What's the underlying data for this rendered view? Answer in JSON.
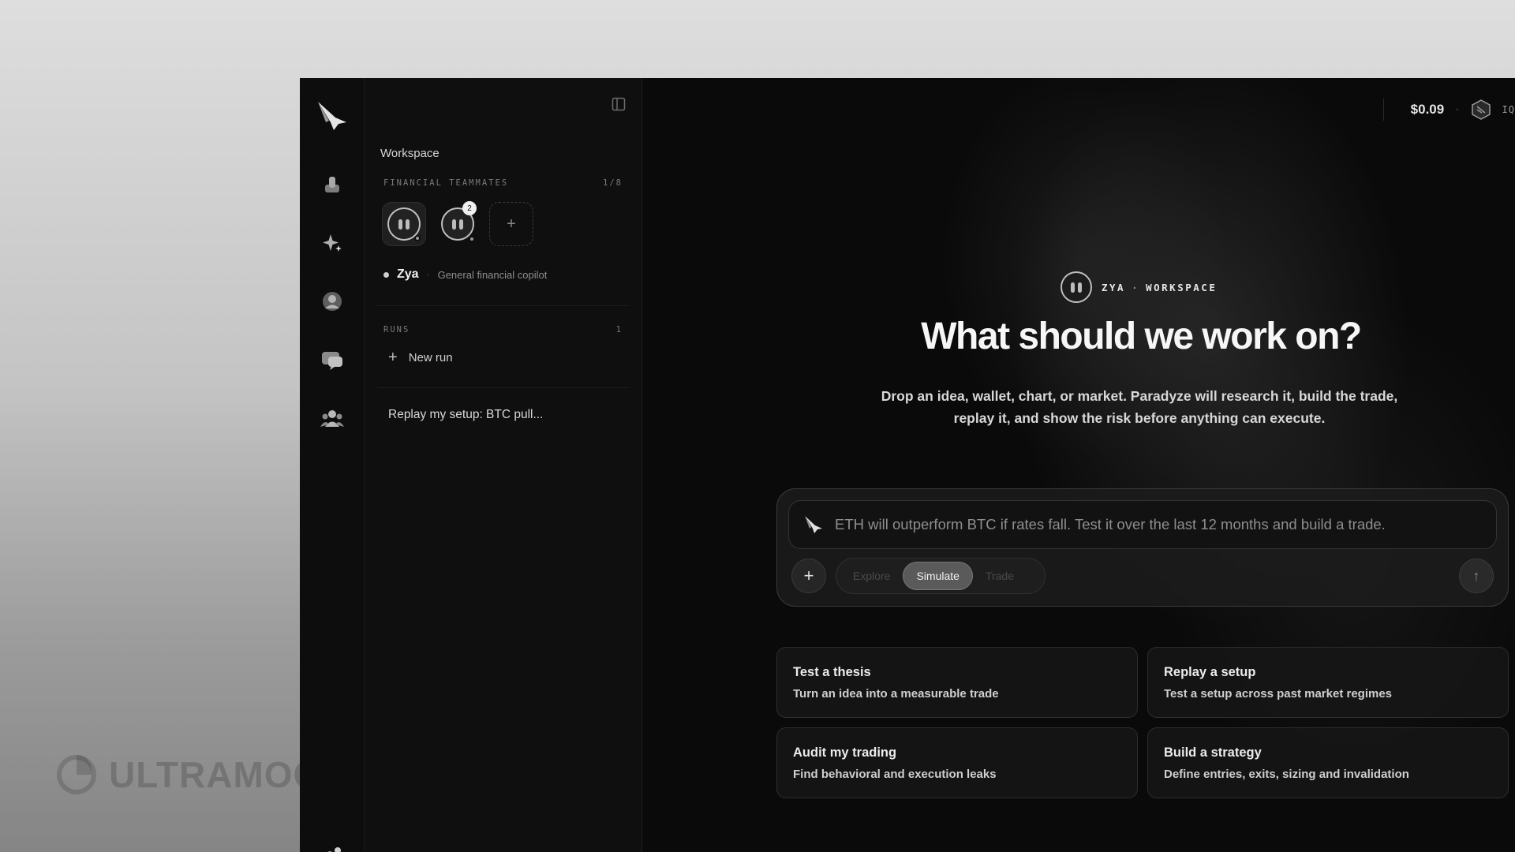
{
  "watermark": {
    "text": "ULTRAMOCK.IO"
  },
  "rail": {
    "icons": [
      "bird-logo-icon",
      "stack-icon",
      "sparkle-icon",
      "user-icon",
      "chat-icon",
      "team-icon"
    ]
  },
  "sidebar": {
    "title": "Workspace",
    "teammates_label": "FINANCIAL TEAMMATES",
    "teammates_count": "1/8",
    "teammate_badge": "2",
    "add_symbol": "+",
    "active_name": "Zya",
    "active_separator": "·",
    "active_role": "General financial copilot",
    "runs_label": "RUNS",
    "runs_count": "1",
    "new_run_label": "New run",
    "runs": [
      "Replay my setup: BTC pull..."
    ]
  },
  "topbar": {
    "balance": "$0.09",
    "separator": "·",
    "iq_label": "IQ"
  },
  "hero": {
    "agent": "ZYA",
    "dot": "·",
    "context": "WORKSPACE",
    "headline": "What should we work on?",
    "subline": "Drop an idea, wallet, chart, or market. Paradyze will research it, build the trade, replay it, and show the risk before anything can execute."
  },
  "composer": {
    "placeholder": "ETH will outperform BTC if rates fall. Test it over the last 12 months and build a trade.",
    "plus": "+",
    "modes": [
      "Explore",
      "Simulate",
      "Trade"
    ],
    "selected_mode": "Simulate",
    "send": "↑"
  },
  "cards": [
    {
      "title": "Test a thesis",
      "desc": "Turn an idea into a measurable trade"
    },
    {
      "title": "Replay a setup",
      "desc": "Test a setup across past market regimes"
    },
    {
      "title": "Audit my trading",
      "desc": "Find behavioral and execution leaks"
    },
    {
      "title": "Build a strategy",
      "desc": "Define entries, exits, sizing and invalidation"
    }
  ]
}
